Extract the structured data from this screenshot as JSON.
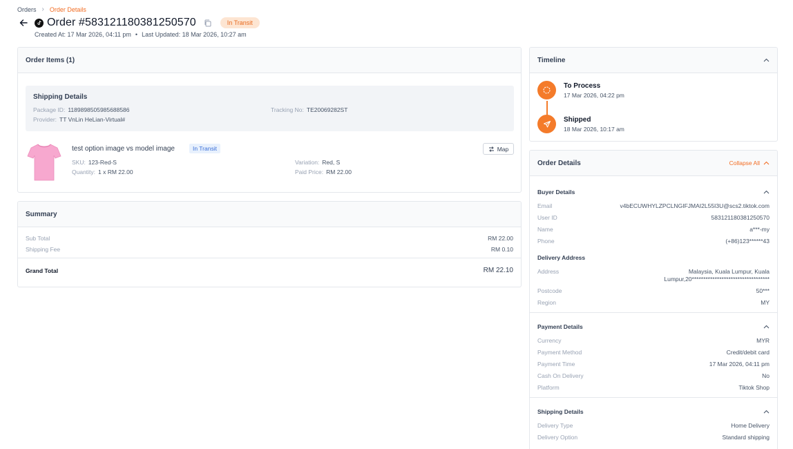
{
  "breadcrumb": {
    "root": "Orders",
    "current": "Order Details"
  },
  "header": {
    "title": "Order #583121180381250570",
    "status": "In Transit",
    "created": "Created At: 17 Mar 2026, 04:11 pm",
    "bullet": "•",
    "updated": "Last Updated: 18 Mar 2026, 10:27 am"
  },
  "order_items": {
    "title": "Order Items (1)",
    "shipping": {
      "title": "Shipping Details",
      "package_label": "Package ID:",
      "package_value": "1189898505985688586",
      "provider_label": "Provider:",
      "provider_value": "TT VnLin HeLian-Virtual#",
      "tracking_label": "Tracking No:",
      "tracking_value": "TE20069282ST"
    },
    "item": {
      "name": "test option image vs model image",
      "status": "In Transit",
      "sku_label": "SKU:",
      "sku_value": "123-Red-S",
      "qty_label": "Quantity:",
      "qty_value": "1 x RM 22.00",
      "variation_label": "Variation:",
      "variation_value": "Red, S",
      "paid_label": "Paid Price:",
      "paid_value": "RM 22.00",
      "map_label": "Map"
    }
  },
  "summary": {
    "title": "Summary",
    "subtotal_label": "Sub Total",
    "subtotal_value": "RM 22.00",
    "shipping_label": "Shipping Fee",
    "shipping_value": "RM 0.10",
    "grand_label": "Grand Total",
    "grand_value": "RM 22.10"
  },
  "timeline": {
    "title": "Timeline",
    "events": [
      {
        "title": "To Process",
        "time": "17 Mar 2026, 04:22 pm"
      },
      {
        "title": "Shipped",
        "time": "18 Mar 2026, 10:17 am"
      }
    ]
  },
  "order_details": {
    "title": "Order Details",
    "collapse_all": "Collapse All",
    "buyer": {
      "title": "Buyer Details",
      "rows": [
        {
          "k": "Email",
          "v": "v4bECUWHYLZPCLNGIFJMAI2L55I3U@scs2.tiktok.com"
        },
        {
          "k": "User ID",
          "v": "583121180381250570"
        },
        {
          "k": "Name",
          "v": "a***-my"
        },
        {
          "k": "Phone",
          "v": "(+86)123******43"
        }
      ]
    },
    "delivery": {
      "title": "Delivery Address",
      "address_label": "Address",
      "address_line1": "Malaysia, Kuala Lumpur, Kuala",
      "address_line2": "Lumpur,20**********************************",
      "postcode_label": "Postcode",
      "postcode_value": "50***",
      "region_label": "Region",
      "region_value": "MY"
    },
    "payment": {
      "title": "Payment Details",
      "rows": [
        {
          "k": "Currency",
          "v": "MYR"
        },
        {
          "k": "Payment Method",
          "v": "Credit/debit card"
        },
        {
          "k": "Payment Time",
          "v": "17 Mar 2026, 04:11 pm"
        },
        {
          "k": "Cash On Delivery",
          "v": "No"
        },
        {
          "k": "Platform",
          "v": "Tiktok Shop"
        }
      ]
    },
    "shipping": {
      "title": "Shipping Details",
      "rows": [
        {
          "k": "Delivery Type",
          "v": "Home Delivery"
        },
        {
          "k": "Delivery Option",
          "v": "Standard shipping"
        }
      ]
    }
  },
  "colors": {
    "accent": "#f47b2a",
    "pill_bg": "#fde5d2",
    "tag_blue": "#3b6fd8"
  }
}
